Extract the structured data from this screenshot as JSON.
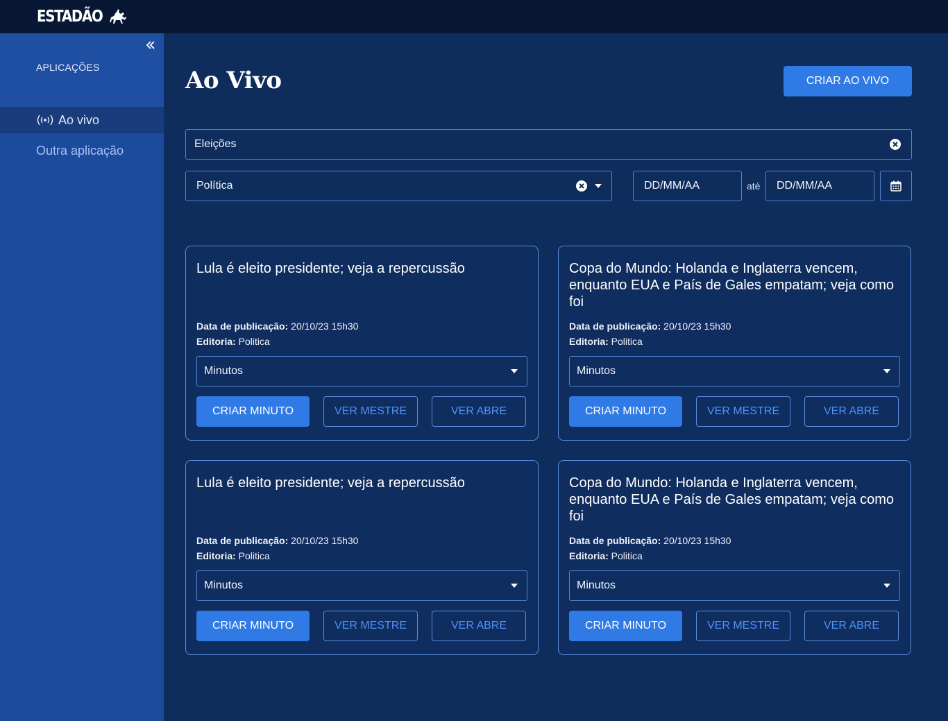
{
  "header": {
    "logo_text": "ESTADÃO"
  },
  "sidebar": {
    "section_label": "APLICAÇÕES",
    "items": [
      {
        "label": "Ao vivo",
        "active": true,
        "icon": "live-broadcast-icon"
      },
      {
        "label": "Outra aplicação",
        "active": false
      }
    ]
  },
  "main": {
    "title": "Ao Vivo",
    "create_button": "CRIAR AO VIVO",
    "filters": {
      "search_value": "Eleições",
      "editoria_value": "Política",
      "date_from_placeholder": "DD/MM/AA",
      "date_separator": "até",
      "date_to_placeholder": "DD/MM/AA"
    },
    "cards": [
      {
        "title": "Lula é eleito presidente; veja a repercussão",
        "pub_label": "Data de publicação:",
        "pub_value": "20/10/23 15h30",
        "editoria_label": "Editoria:",
        "editoria_value": "Politica",
        "select_value": "Minutos",
        "btn_create": "CRIAR MINUTO",
        "btn_master": "VER MESTRE",
        "btn_abre": "VER ABRE"
      },
      {
        "title": "Copa do Mundo: Holanda e Inglaterra vencem, enquanto EUA e País de Gales empatam; veja como foi",
        "pub_label": "Data de publicação:",
        "pub_value": "20/10/23 15h30",
        "editoria_label": "Editoria:",
        "editoria_value": "Politica",
        "select_value": "Minutos",
        "btn_create": "CRIAR MINUTO",
        "btn_master": "VER MESTRE",
        "btn_abre": "VER ABRE"
      },
      {
        "title": "Lula é eleito presidente; veja a repercussão",
        "pub_label": "Data de publicação:",
        "pub_value": "20/10/23 15h30",
        "editoria_label": "Editoria:",
        "editoria_value": "Politica",
        "select_value": "Minutos",
        "btn_create": "CRIAR MINUTO",
        "btn_master": "VER MESTRE",
        "btn_abre": "VER ABRE"
      },
      {
        "title": "Copa do Mundo: Holanda e Inglaterra vencem, enquanto EUA e País de Gales empatam; veja como foi",
        "pub_label": "Data de publicação:",
        "pub_value": "20/10/23 15h30",
        "editoria_label": "Editoria:",
        "editoria_value": "Politica",
        "select_value": "Minutos",
        "btn_create": "CRIAR MINUTO",
        "btn_master": "VER MESTRE",
        "btn_abre": "VER ABRE"
      }
    ]
  },
  "colors": {
    "background": "#0e2c5c",
    "topbar": "#081834",
    "sidebar": "#1c4a9c",
    "accent": "#2f7ae5",
    "outline": "#5a8ee0"
  }
}
